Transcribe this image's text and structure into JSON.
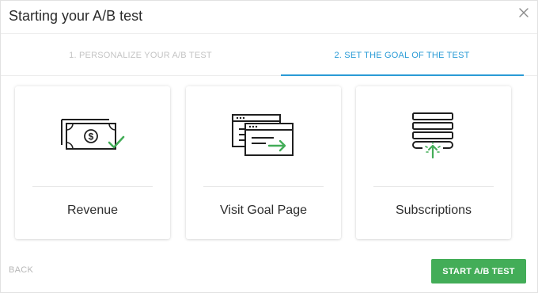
{
  "header": {
    "title": "Starting your A/B test",
    "close_icon": "close-icon"
  },
  "steps": [
    {
      "label": "1. PERSONALIZE YOUR A/B TEST",
      "active": false
    },
    {
      "label": "2. SET THE GOAL OF THE TEST",
      "active": true
    }
  ],
  "goals": [
    {
      "label": "Revenue",
      "icon": "revenue-icon"
    },
    {
      "label": "Visit Goal Page",
      "icon": "visit-page-icon"
    },
    {
      "label": "Subscriptions",
      "icon": "subscriptions-icon"
    }
  ],
  "footer": {
    "back_label": "BACK",
    "start_label": "START A/B TEST"
  },
  "colors": {
    "accent": "#2a9bd6",
    "success": "#43ad58",
    "muted": "#c4c4c4"
  }
}
